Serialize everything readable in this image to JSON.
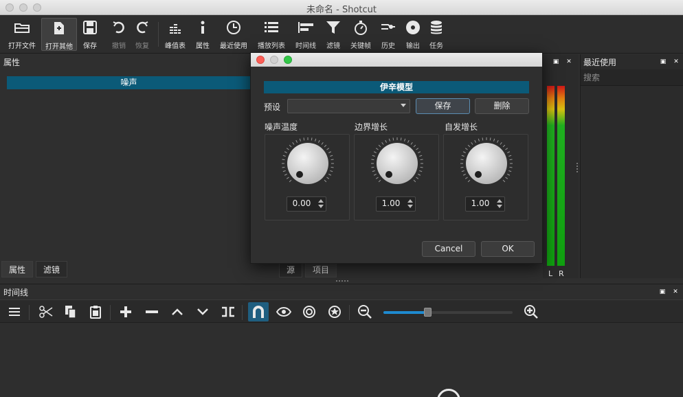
{
  "window": {
    "title": "未命名 - Shotcut"
  },
  "toolbar": {
    "items": [
      {
        "label": "打开文件",
        "icon": "open-folder-icon"
      },
      {
        "label": "打开其他",
        "icon": "open-other-icon"
      },
      {
        "label": "保存",
        "icon": "save-icon"
      },
      {
        "label": "撤销",
        "icon": "undo-icon"
      },
      {
        "label": "恢复",
        "icon": "redo-icon"
      },
      {
        "label": "峰值表",
        "icon": "peak-meter-icon"
      },
      {
        "label": "属性",
        "icon": "info-icon"
      },
      {
        "label": "最近使用",
        "icon": "clock-icon"
      },
      {
        "label": "播放列表",
        "icon": "playlist-icon"
      },
      {
        "label": "时间线",
        "icon": "timeline-icon"
      },
      {
        "label": "滤镜",
        "icon": "filter-icon"
      },
      {
        "label": "关键帧",
        "icon": "stopwatch-icon"
      },
      {
        "label": "历史",
        "icon": "history-icon"
      },
      {
        "label": "输出",
        "icon": "disc-icon"
      },
      {
        "label": "任务",
        "icon": "stack-icon"
      }
    ]
  },
  "properties": {
    "title": "属性",
    "filter_name": "噪声",
    "tabs": [
      "属性",
      "滤镜"
    ],
    "source_tabs": [
      "源",
      "项目"
    ]
  },
  "meter": {
    "left_label": "L",
    "right_label": "R"
  },
  "recent": {
    "title": "最近使用",
    "search_placeholder": "搜索"
  },
  "timeline": {
    "title": "时间线",
    "zoom_level": 0.34
  },
  "dialog": {
    "header": "伊辛模型",
    "preset_label": "预设",
    "preset_value": "",
    "save_label": "保存",
    "delete_label": "删除",
    "params": [
      {
        "label": "噪声温度",
        "value": "0.00"
      },
      {
        "label": "边界增长",
        "value": "1.00"
      },
      {
        "label": "自发增长",
        "value": "1.00"
      }
    ],
    "cancel_label": "Cancel",
    "ok_label": "OK"
  },
  "colors": {
    "accent": "#0b5a78",
    "bg": "#2f2f2f",
    "snap_on": "#1f5e80"
  }
}
